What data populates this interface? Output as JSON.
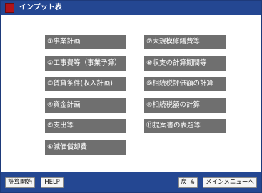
{
  "window": {
    "title": "インプット表",
    "accent": "#244792",
    "icon": "app-icon"
  },
  "menu": {
    "left": [
      "①事業計画",
      "②工事費等（事業予算）",
      "③賃貸条件(収入計画)",
      "④資金計画",
      "⑤支出等",
      "⑥減価償却費"
    ],
    "right": [
      "⑦大規模修繕費等",
      "⑧収支の計算期間等",
      "⑨相続税評価額の計算",
      "⑩相続税額の計算",
      "⑪提案書の表題等"
    ]
  },
  "footer": {
    "calc_start": "計算開始",
    "help": "HELP",
    "back": "戻 る",
    "main_menu": "メインメニューへ"
  }
}
